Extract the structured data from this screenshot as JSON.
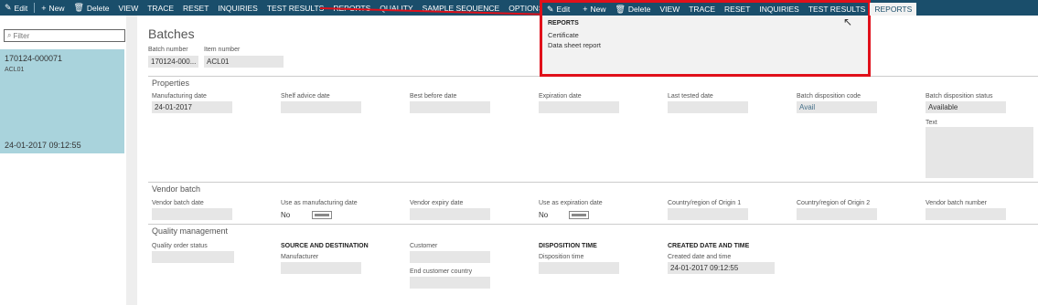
{
  "toolbar": {
    "edit": "Edit",
    "new": "New",
    "delete": "Delete",
    "view": "VIEW",
    "trace": "TRACE",
    "reset": "RESET",
    "inquiries": "INQUIRIES",
    "test_results": "TEST RESULTS",
    "reports": "REPORTS",
    "quality": "QUALITY",
    "sample_sequence": "SAMPLE SEQUENCE",
    "options": "OPTIONS"
  },
  "left": {
    "filter_placeholder": "Filter",
    "item_id": "170124-000071",
    "item_number": "ACL01",
    "item_date": "24-01-2017 09:12:55"
  },
  "page": {
    "title": "Batches",
    "batch_number_label": "Batch number",
    "batch_number_value": "170124-000...",
    "item_number_label": "Item number",
    "item_number_value": "ACL01"
  },
  "properties": {
    "title": "Properties",
    "manufacturing_date_label": "Manufacturing date",
    "manufacturing_date_value": "24-01-2017",
    "shelf_advice_label": "Shelf advice date",
    "best_before_label": "Best before date",
    "expiration_label": "Expiration date",
    "last_tested_label": "Last tested date",
    "disp_code_label": "Batch disposition code",
    "disp_code_value": "Avail",
    "disp_status_label": "Batch disposition status",
    "disp_status_value": "Available",
    "text_label": "Text"
  },
  "vendor": {
    "title": "Vendor batch",
    "vendor_batch_date_label": "Vendor batch date",
    "use_mfg_label": "Use as manufacturing date",
    "use_mfg_value": "No",
    "vendor_expiry_label": "Vendor expiry date",
    "use_exp_label": "Use as expiration date",
    "use_exp_value": "No",
    "country1_label": "Country/region of Origin 1",
    "country2_label": "Country/region of Origin 2",
    "vendor_batch_number_label": "Vendor batch number"
  },
  "quality": {
    "title": "Quality management",
    "order_status_label": "Quality order status",
    "source_dest_header": "SOURCE AND DESTINATION",
    "manufacturer_label": "Manufacturer",
    "customer_label": "Customer",
    "end_customer_country_label": "End customer country",
    "disposition_time_header": "DISPOSITION TIME",
    "disposition_time_label": "Disposition time",
    "created_header": "CREATED DATE AND TIME",
    "created_label": "Created date and time",
    "created_value": "24-01-2017 09:12:55"
  },
  "dropdown": {
    "edit": "Edit",
    "new": "New",
    "delete": "Delete",
    "view": "VIEW",
    "trace": "TRACE",
    "reset": "RESET",
    "inquiries": "INQUIRIES",
    "test_results": "TEST RESULTS",
    "reports": "REPORTS",
    "section_header": "REPORTS",
    "certificate": "Certificate",
    "data_sheet_report": "Data sheet report"
  },
  "colors": {
    "topbar": "#1a4e6b",
    "selected_row": "#a9d3dc",
    "highlight": "#e0101a"
  }
}
